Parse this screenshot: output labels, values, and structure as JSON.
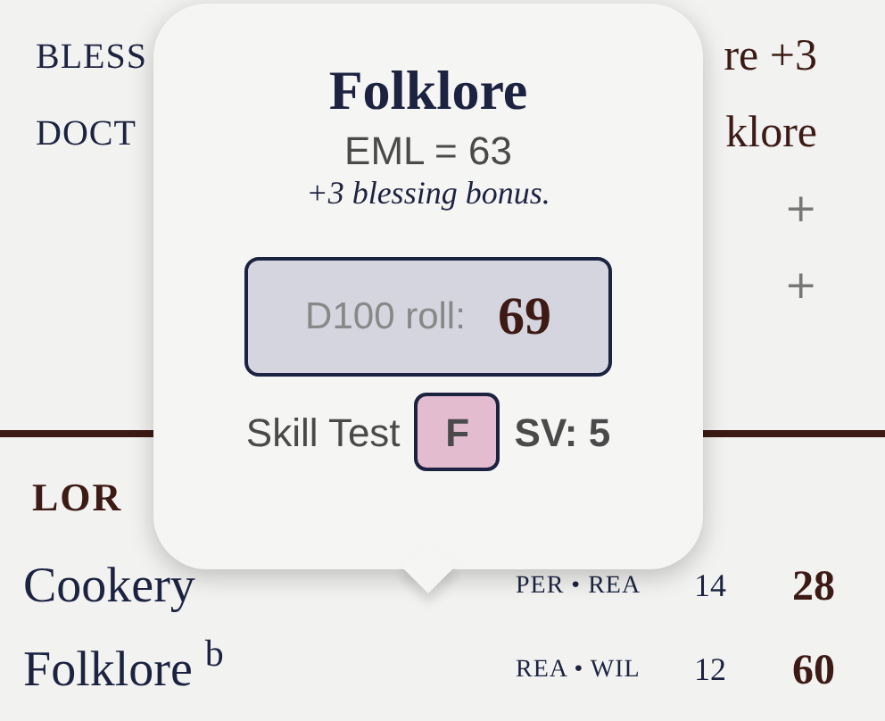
{
  "features": [
    {
      "label": "BLESS",
      "value": "re +3"
    },
    {
      "label": "DOCT",
      "value": "klore"
    }
  ],
  "add_buttons": [
    "+",
    "+"
  ],
  "lore": {
    "heading": "LOR",
    "skills": [
      {
        "name": "Cookery",
        "attributes": "PER • REA",
        "base": "14",
        "value": "28"
      },
      {
        "name": "Folklore $^{b}$",
        "attributes": "REA • WIL",
        "base": "12",
        "value": "60"
      }
    ]
  },
  "popover": {
    "title": "Folklore",
    "eml": "EML = 63",
    "note": "+3 blessing bonus.",
    "roll_label": "D100 roll:",
    "roll_value": "69",
    "test_label": "Skill Test",
    "result": "F",
    "sv": "SV: 5"
  }
}
